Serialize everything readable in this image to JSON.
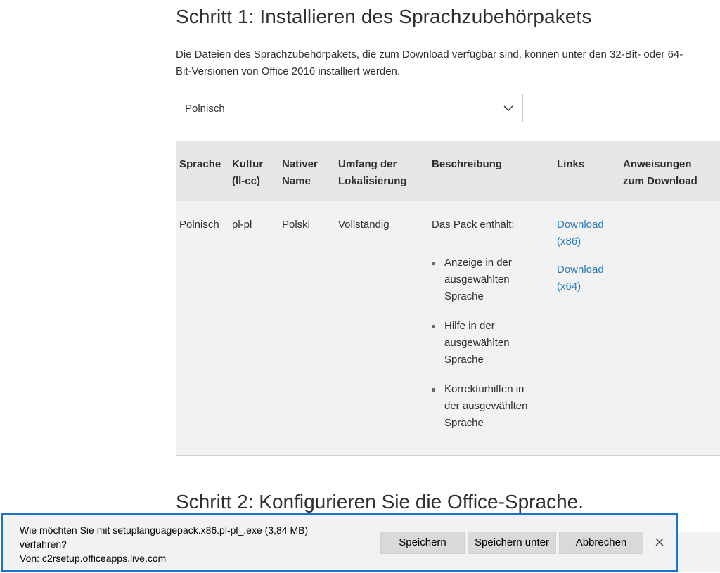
{
  "step1": {
    "title": "Schritt 1: Installieren des Sprachzubehörpakets",
    "intro_line1": "Die Dateien des Sprachzubehörpakets, die zum Download verfügbar sind, können unter den 32-Bit- oder 64-",
    "intro_line2": "Bit-Versionen von Office 2016 installiert werden."
  },
  "language_select": {
    "selected": "Polnisch",
    "icon": "chevron-down-icon"
  },
  "table": {
    "headers": {
      "sprache": "Sprache",
      "kultur_l1": "Kultur",
      "kultur_l2": "(ll-cc)",
      "nativer_l1": "Nativer",
      "nativer_l2": "Name",
      "umfang_l1": "Umfang der",
      "umfang_l2": "Lokalisierung",
      "beschreibung": "Beschreibung",
      "links": "Links",
      "anweisungen_l1": "Anweisungen",
      "anweisungen_l2": "zum Download"
    },
    "row": {
      "sprache": "Polnisch",
      "kultur": "pl-pl",
      "nativer_name": "Polski",
      "umfang": "Vollständig",
      "beschreibung_intro": "Das Pack enthält:",
      "bullets": [
        {
          "l1": "Anzeige in der",
          "l2": "ausgewählten",
          "l3": "Sprache"
        },
        {
          "l1": "Hilfe in der",
          "l2": "ausgewählten",
          "l3": "Sprache"
        },
        {
          "l1": "Korrekturhilfen in",
          "l2": "der ausgewählten",
          "l3": "Sprache"
        }
      ],
      "link_x86_l1": "Download",
      "link_x86_l2": "(x86)",
      "link_x64_l1": "Download",
      "link_x64_l2": "(x64)"
    }
  },
  "step2": {
    "title": "Schritt 2: Konfigurieren Sie die Office-Sprache."
  },
  "download_bar": {
    "line1": "Wie möchten Sie mit setuplanguagepack.x86.pl-pl_.exe (3,84 MB)",
    "line2": "verfahren?",
    "line3": "Von: c2rsetup.officeapps.live.com",
    "save": "Speichern",
    "save_as": "Speichern unter",
    "cancel": "Abbrechen",
    "close_icon": "close-icon",
    "colors": {
      "border": "#1a73c7",
      "background": "#f2f2f2",
      "link": "#2a7ab7"
    }
  }
}
